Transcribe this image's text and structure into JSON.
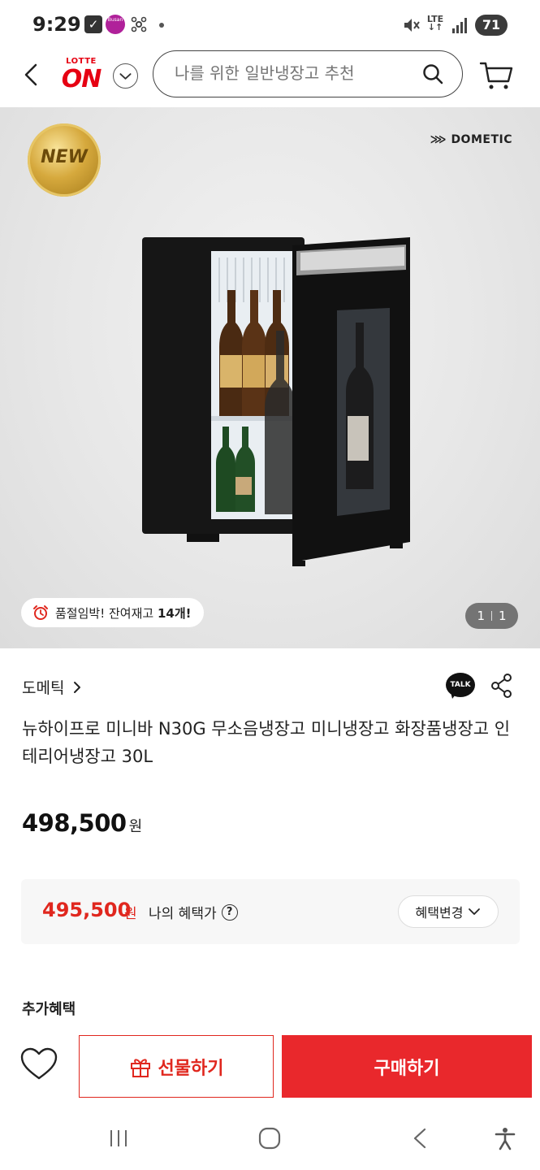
{
  "status_bar": {
    "time": "9:29",
    "network": "LTE",
    "battery": "71",
    "busan_label": "Busan"
  },
  "header": {
    "logo_top": "LOTTE",
    "logo_main": "ON",
    "search_placeholder": "나를 위한 일반냉장고 추천"
  },
  "hero": {
    "badge": "NEW",
    "brand_logo": "DOMETIC",
    "stock_text": "품절임박! 잔여재고 ",
    "stock_count": "14개!",
    "image_index": "1",
    "image_total": "1"
  },
  "product": {
    "brand": "도메틱",
    "title": "뉴하이프로 미니바 N30G 무소음냉장고 미니냉장고 화장품냉장고 인테리어냉장고 30L",
    "price": "498,500",
    "currency": "원"
  },
  "benefit": {
    "price": "495,500",
    "currency": "원",
    "label": "나의 혜택가",
    "help": "?",
    "change_label": "혜택변경"
  },
  "extra_benefit_label": "추가혜택",
  "talk_label": "TALK",
  "bottom_bar": {
    "gift_label": "선물하기",
    "buy_label": "구매하기"
  },
  "colors": {
    "brand_red": "#e60012",
    "price_red": "#e0271e",
    "buy_button": "#e9282c"
  }
}
